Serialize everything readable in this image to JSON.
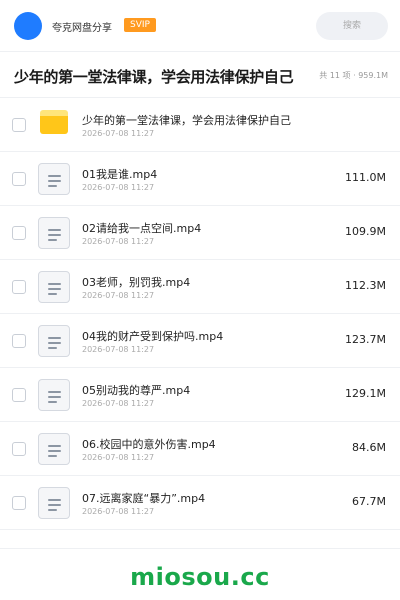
{
  "header": {
    "brand": "夸克网盘分享",
    "badge": "SVIP",
    "search_placeholder": "搜索"
  },
  "share": {
    "title": "少年的第一堂法律课，学会用法律保护自己",
    "summary": "共 11 项 · 959.1M"
  },
  "files": [
    {
      "type": "folder",
      "name": "少年的第一堂法律课，学会用法律保护自己",
      "date": "2026-07-08 11:27",
      "size": ""
    },
    {
      "type": "file",
      "name": "01我是谁.mp4",
      "date": "2026-07-08 11:27",
      "size": "111.0M"
    },
    {
      "type": "file",
      "name": "02请给我一点空间.mp4",
      "date": "2026-07-08 11:27",
      "size": "109.9M"
    },
    {
      "type": "file",
      "name": "03老师，别罚我.mp4",
      "date": "2026-07-08 11:27",
      "size": "112.3M"
    },
    {
      "type": "file",
      "name": "04我的财产受到保护吗.mp4",
      "date": "2026-07-08 11:27",
      "size": "123.7M"
    },
    {
      "type": "file",
      "name": "05别动我的尊严.mp4",
      "date": "2026-07-08 11:27",
      "size": "129.1M"
    },
    {
      "type": "file",
      "name": "06.校园中的意外伤害.mp4",
      "date": "2026-07-08 11:27",
      "size": "84.6M"
    },
    {
      "type": "file",
      "name": "07.远离家庭“暴力”.mp4",
      "date": "2026-07-08 11:27",
      "size": "67.7M"
    }
  ],
  "footer": {
    "watermark": "miosou.cc"
  },
  "colors": {
    "brand_blue": "#1f7cff",
    "svip_orange": "#ff9a1f",
    "folder_yellow": "#ffc619",
    "watermark_green": "#1aa84b"
  },
  "icons": {
    "avatar": "avatar-circle",
    "folder": "folder-icon",
    "file": "document-icon",
    "checkbox": "checkbox-icon"
  }
}
